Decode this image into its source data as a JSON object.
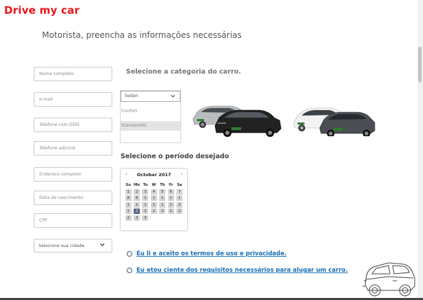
{
  "brand": "Drive my car",
  "subtitle": "Motorista, preencha as informações necessárias",
  "form": {
    "full_name_placeholder": "Nome completo",
    "email_placeholder": "e-mail",
    "phone_placeholder": "Telefone com DDD",
    "extra_phone_placeholder": "Telefone adicinal",
    "address_placeholder": "Endereço completo",
    "birthdate_placeholder": "Data de nascimento",
    "cpf_placeholder": "CPF",
    "city_select": "Selecione sua cidade"
  },
  "category": {
    "label": "Selecione a categoria do carro.",
    "selected": "Sedan",
    "options": [
      "Confort",
      "Standardd2"
    ]
  },
  "period": {
    "label": "Selecione o período desejado"
  },
  "calendar": {
    "title": "October 2017",
    "prev": "‹",
    "next": "›",
    "weekdays": [
      "Su",
      "Mo",
      "Tu",
      "W",
      "Th",
      "Fr",
      "Sa"
    ],
    "weeks": [
      [
        "1",
        "2",
        "3",
        "4",
        "5",
        "6",
        "7"
      ],
      [
        "8",
        "9",
        "1",
        "1",
        "1",
        "1",
        "1"
      ],
      [
        "1",
        "1",
        "1",
        "1",
        "1",
        "2",
        "2"
      ],
      [
        "2",
        "2",
        "2",
        "2",
        "2",
        "2",
        "2"
      ],
      [
        "2",
        "3",
        "3",
        "",
        "",
        "",
        ""
      ]
    ],
    "selected_week": 3,
    "selected_day": 1
  },
  "terms": {
    "accept_terms": "Eu li e aceito os termos de uso e privacidade.",
    "aware_requirements": "Eu etou ciente dos requisitos necessários para alugar um carro."
  },
  "colors": {
    "brand": "#e8151b",
    "link": "#1a6fb3",
    "calendar_selected": "#5a6b86"
  },
  "icons": {
    "city_dropdown": "chevron-down-icon",
    "category_dropdown": "chevron-down-icon",
    "illustration": "suv-outline-illustration"
  }
}
